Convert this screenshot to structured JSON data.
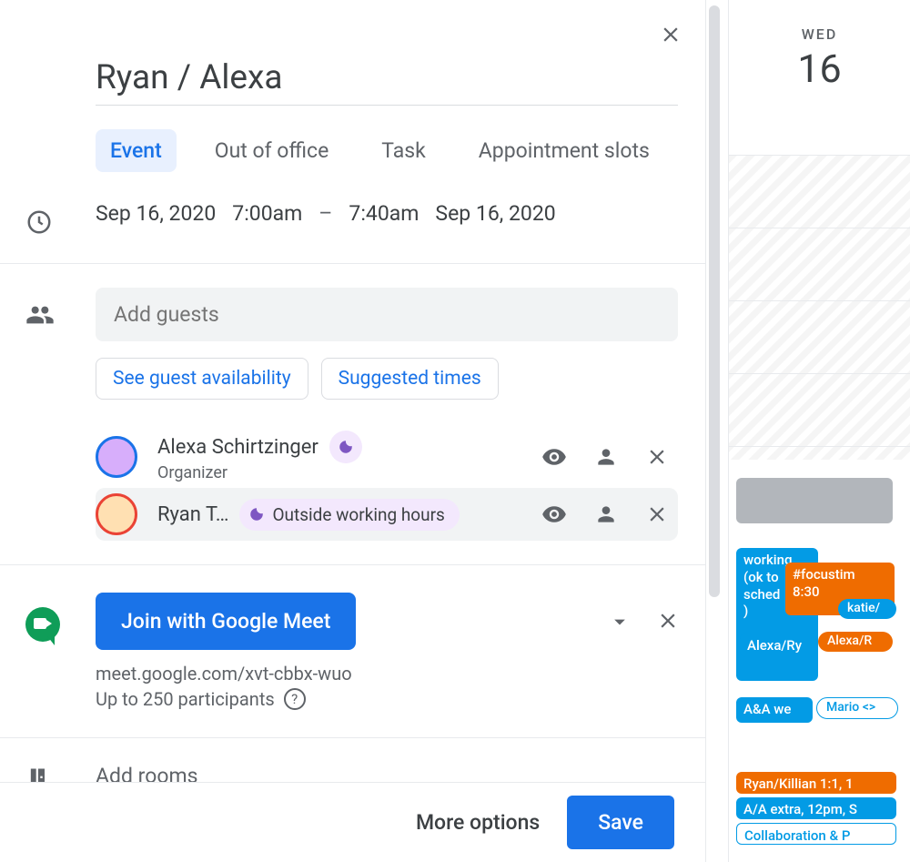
{
  "title": "Ryan / Alexa",
  "tabs": {
    "event": "Event",
    "ooo": "Out of office",
    "task": "Task",
    "slots": "Appointment slots"
  },
  "time": {
    "start_date": "Sep 16, 2020",
    "start_time": "7:00am",
    "dash": "–",
    "end_time": "7:40am",
    "end_date": "Sep 16, 2020"
  },
  "guests": {
    "placeholder": "Add guests",
    "availability_btn": "See guest availability",
    "suggested_btn": "Suggested times",
    "list": [
      {
        "name": "Alexa Schirtzinger",
        "sub": "Organizer",
        "status": ""
      },
      {
        "name": "Ryan T…",
        "sub": "",
        "status": "Outside working hours"
      }
    ]
  },
  "meet": {
    "button": "Join with Google Meet",
    "link": "meet.google.com/xvt-cbbx-wuo",
    "capacity": "Up to 250 participants"
  },
  "rooms": {
    "placeholder": "Add rooms"
  },
  "footer": {
    "more": "More options",
    "save": "Save"
  },
  "day": {
    "name": "WED",
    "num": "16",
    "events": {
      "working": "working",
      "okto": "(ok to",
      "sched": "sched",
      "closep": ")",
      "focus": "#focustim",
      "focus_time": "8:30",
      "katie": "katie/",
      "alexar1": "Alexa/Ry",
      "alexar2": "Alexa/R",
      "aawe": "A&A we",
      "mario": "Mario <>",
      "ryankillian": "Ryan/Killian 1:1, 1",
      "aaextra": "A/A extra, 12pm, S",
      "collab": "Collaboration & P"
    }
  }
}
